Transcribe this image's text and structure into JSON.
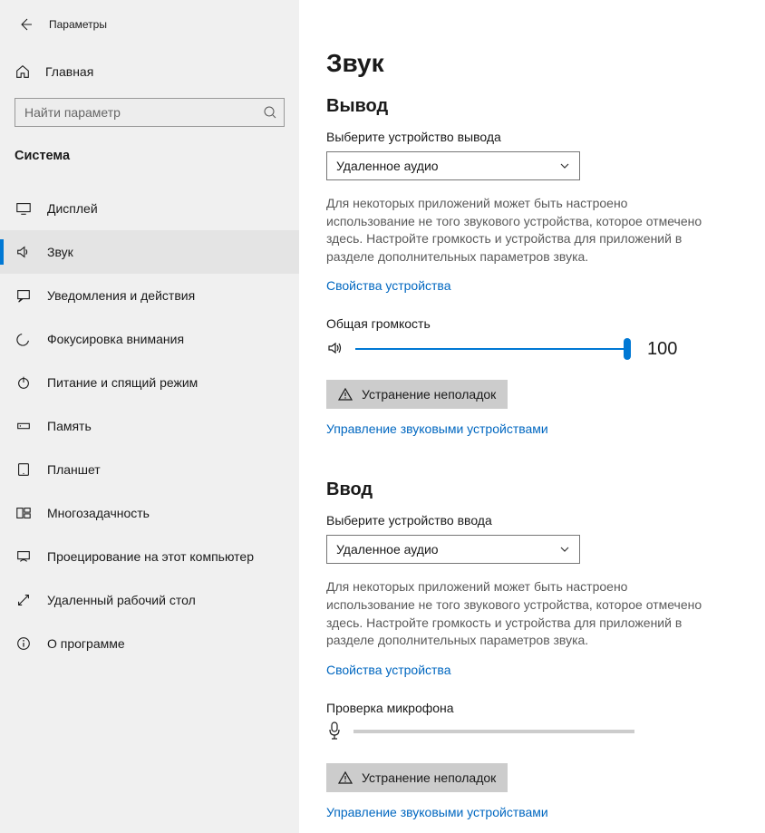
{
  "header": {
    "title": "Параметры"
  },
  "home": {
    "label": "Главная"
  },
  "search": {
    "placeholder": "Найти параметр"
  },
  "section": {
    "title": "Система"
  },
  "nav": [
    {
      "id": "display",
      "label": "Дисплей",
      "active": false
    },
    {
      "id": "sound",
      "label": "Звук",
      "active": true
    },
    {
      "id": "notifications",
      "label": "Уведомления и действия",
      "active": false
    },
    {
      "id": "focus",
      "label": "Фокусировка внимания",
      "active": false
    },
    {
      "id": "power",
      "label": "Питание и спящий режим",
      "active": false
    },
    {
      "id": "storage",
      "label": "Память",
      "active": false
    },
    {
      "id": "tablet",
      "label": "Планшет",
      "active": false
    },
    {
      "id": "multitask",
      "label": "Многозадачность",
      "active": false
    },
    {
      "id": "projecting",
      "label": "Проецирование на этот компьютер",
      "active": false
    },
    {
      "id": "remote",
      "label": "Удаленный рабочий стол",
      "active": false
    },
    {
      "id": "about",
      "label": "О программе",
      "active": false
    }
  ],
  "page": {
    "title": "Звук"
  },
  "output": {
    "heading": "Вывод",
    "select_label": "Выберите устройство вывода",
    "selected": "Удаленное аудио",
    "helper": "Для некоторых приложений может быть настроено использование не того звукового устройства, которое отмечено здесь. Настройте громкость и устройства для приложений в разделе дополнительных параметров звука.",
    "device_props": "Свойства устройства",
    "volume_label": "Общая громкость",
    "volume_value": "100",
    "troubleshoot": "Устранение неполадок",
    "manage": "Управление звуковыми устройствами"
  },
  "input": {
    "heading": "Ввод",
    "select_label": "Выберите устройство ввода",
    "selected": "Удаленное аудио",
    "helper": "Для некоторых приложений может быть настроено использование не того звукового устройства, которое отмечено здесь. Настройте громкость и устройства для приложений в разделе дополнительных параметров звука.",
    "device_props": "Свойства устройства",
    "mic_test_label": "Проверка микрофона",
    "troubleshoot": "Устранение неполадок",
    "manage": "Управление звуковыми устройствами"
  }
}
